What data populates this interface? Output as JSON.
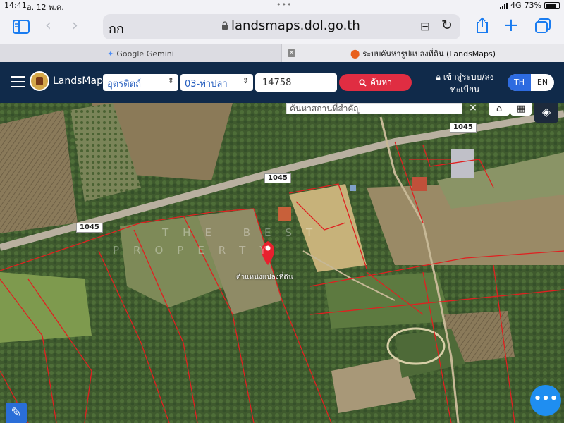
{
  "status_bar": {
    "time": "14:41",
    "date": "อ. 12 พ.ค.",
    "network": "4G",
    "battery": "73%"
  },
  "browser": {
    "text_size_label": "กก",
    "url": "landsmaps.dol.go.th",
    "tabs": [
      {
        "label": "Google Gemini"
      },
      {
        "label": "ระบบค้นหารูปแปลงที่ดิน (LandsMaps)"
      }
    ]
  },
  "header": {
    "brand": "LandsMaps",
    "province_select": "อุตรดิตถ์",
    "district_select": "03-ท่าปลา",
    "parcel_number": "14758",
    "search_button": "ค้นหา",
    "login_label": "เข้าสู่ระบบ/ลงทะเบียน",
    "lang_th": "TH",
    "lang_en": "EN"
  },
  "map": {
    "place_search_placeholder": "ค้นหาสถานที่สำคัญ",
    "road_labels": [
      "1045",
      "1045",
      "1045"
    ],
    "watermark_line1": "THE BEST",
    "watermark_line2": "PROPERTY",
    "pin_label": "ตำแหน่งแปลงที่ดิน",
    "parcel_border_color": "#e02020",
    "pin_color": "#e8212e"
  }
}
